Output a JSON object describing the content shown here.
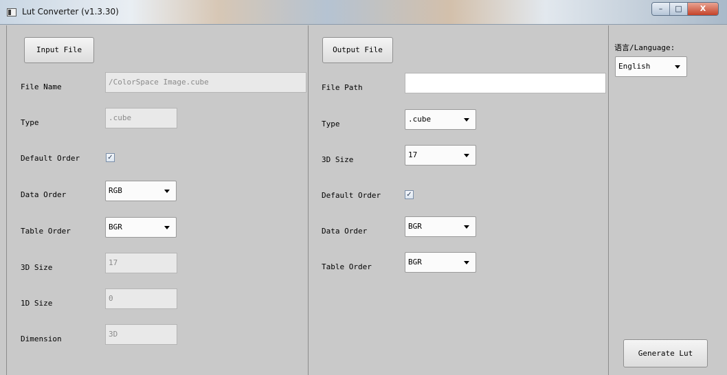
{
  "window": {
    "title": "Lut Converter (v1.3.30)",
    "minimize_glyph": "–",
    "maximize_glyph": "□",
    "close_glyph": "X"
  },
  "input": {
    "button_label": "Input File",
    "file_name_label": "File Name",
    "file_name_value": "/ColorSpace Image.cube",
    "type_label": "Type",
    "type_value": ".cube",
    "default_order_label": "Default Order",
    "default_order_checked": true,
    "data_order_label": "Data Order",
    "data_order_value": "RGB",
    "table_order_label": "Table Order",
    "table_order_value": "BGR",
    "size3d_label": "3D Size",
    "size3d_value": "17",
    "size1d_label": "1D Size",
    "size1d_value": "0",
    "dimension_label": "Dimension",
    "dimension_value": "3D"
  },
  "output": {
    "button_label": "Output File",
    "file_path_label": "File Path",
    "file_path_value": "",
    "type_label": "Type",
    "type_value": ".cube",
    "size3d_label": "3D Size",
    "size3d_value": "17",
    "default_order_label": "Default Order",
    "default_order_checked": true,
    "data_order_label": "Data Order",
    "data_order_value": "BGR",
    "table_order_label": "Table Order",
    "table_order_value": "BGR"
  },
  "language": {
    "label": "语言/Language:",
    "value": "English"
  },
  "actions": {
    "generate_label": "Generate Lut"
  },
  "icons": {
    "checkbox_check": "✓"
  }
}
